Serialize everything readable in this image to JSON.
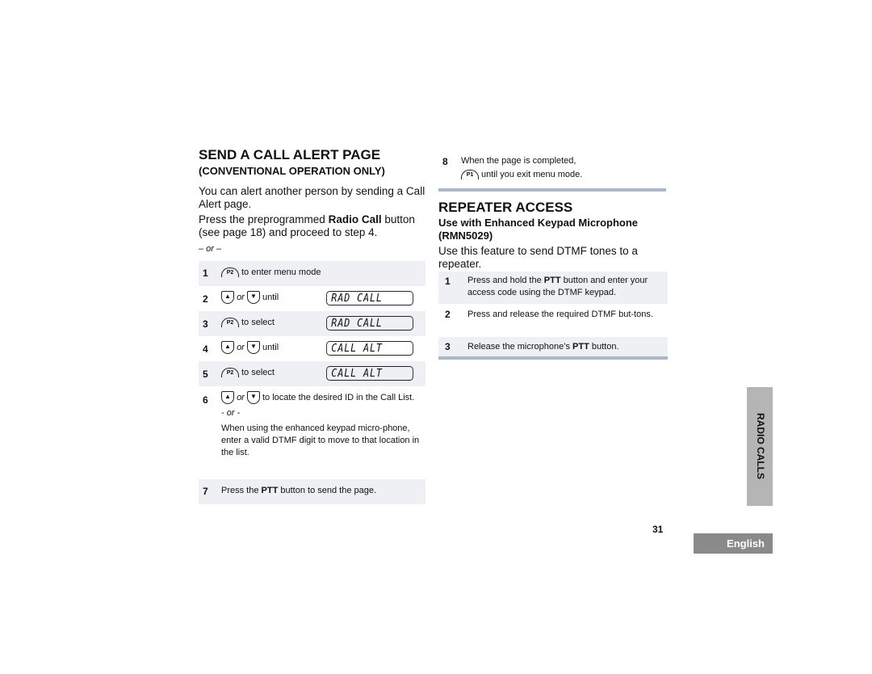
{
  "left": {
    "title": "SEND A CALL ALERT PAGE",
    "subtitle": "(CONVENTIONAL OPERATION ONLY)",
    "para1": "You can alert another person by sending a Call Alert page.",
    "para2_pre": "Press the preprogrammed ",
    "para2_bold": "Radio Call",
    "para2_post": " button (see page 18) and proceed to step 4.",
    "or": "– or –",
    "steps": [
      {
        "num": "1",
        "button": "P2",
        "text": "to enter menu mode"
      },
      {
        "num": "2",
        "or": "or",
        "text": "until",
        "display": "RAD CALL"
      },
      {
        "num": "3",
        "button": "P2",
        "text": "to select",
        "display": "RAD CALL"
      },
      {
        "num": "4",
        "or": "or",
        "text": "until",
        "display": "CALL ALT"
      },
      {
        "num": "5",
        "button": "P2",
        "text": "to select",
        "display": "CALL ALT"
      },
      {
        "num": "6",
        "or": "or",
        "text": "to locate the desired ID in the Call List.",
        "or2": "- or -",
        "text2": "When using the enhanced keypad micro-phone, enter a valid DTMF digit to move to that location in the list."
      },
      {
        "num": "7",
        "pre": "Press the ",
        "bold": "PTT",
        "post": " button to send the page."
      }
    ]
  },
  "right": {
    "step8": {
      "num": "8",
      "text": "When the page is completed,",
      "button": "P1",
      "text2": "until you exit menu mode."
    },
    "title": "REPEATER ACCESS",
    "subtitle": "Use with Enhanced Keypad Microphone (RMN5029)",
    "para": "Use this feature to send DTMF tones to a repeater.",
    "steps": [
      {
        "num": "1",
        "pre": "Press and hold the ",
        "bold": "PTT",
        "post": " button and enter your access code using the DTMF keypad."
      },
      {
        "num": "2",
        "pre": "Press and release the required DTMF but-tons.",
        "bold": "",
        "post": ""
      },
      {
        "num": "3",
        "pre": "Release the microphone’s ",
        "bold": "PTT",
        "post": " button."
      }
    ]
  },
  "side_tab": "RADIO CALLS",
  "page_number": "31",
  "language_tab": "English"
}
